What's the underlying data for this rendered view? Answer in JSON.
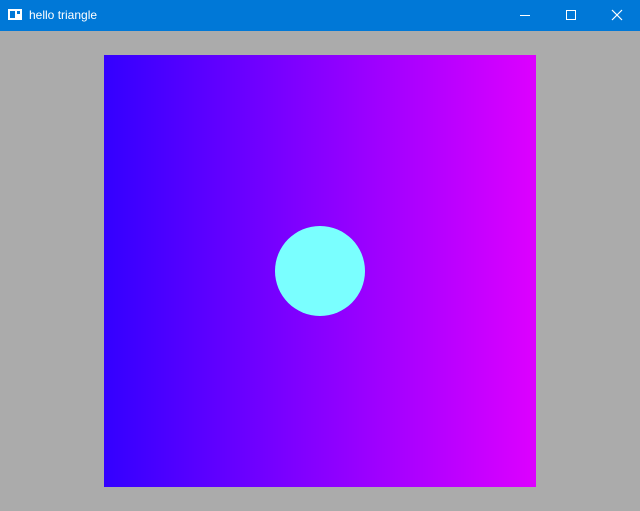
{
  "window": {
    "title": "hello triangle",
    "icon": "window-app-icon",
    "controls": {
      "minimize_icon": "minimize-icon",
      "maximize_icon": "maximize-icon",
      "close_icon": "close-icon"
    }
  },
  "colors": {
    "titlebar": "#0078d7",
    "background": "#ababab",
    "gradient_left": "#3300ff",
    "gradient_right": "#dd00ff",
    "circle": "#7affff"
  }
}
